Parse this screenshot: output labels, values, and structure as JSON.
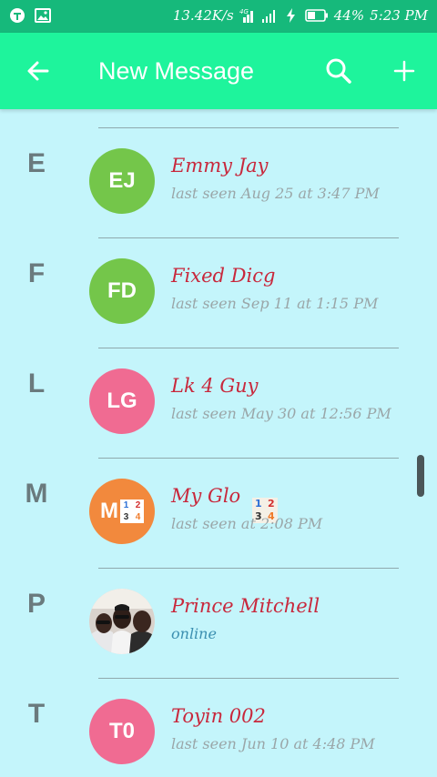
{
  "status_bar": {
    "net_speed": "13.42K/s",
    "battery": "44%",
    "time": "5:23 PM",
    "icons": [
      "app-notification-icon",
      "gallery-notification-icon",
      "lte-signal-icon",
      "signal-bars-icon",
      "charging-icon",
      "battery-icon"
    ]
  },
  "toolbar": {
    "title": "New Message",
    "back_icon": "arrow-left-icon",
    "search_icon": "search-icon",
    "add_icon": "plus-icon"
  },
  "contacts": [
    {
      "letter": "E",
      "initials": "EJ",
      "name": "Emmy Jay",
      "status": "last seen Aug 25 at 3:47 PM",
      "avatar_color": "#74c64a"
    },
    {
      "letter": "F",
      "initials": "FD",
      "name": "Fixed Dicg",
      "status": "last seen Sep 11 at 1:15 PM",
      "avatar_color": "#74c64a"
    },
    {
      "letter": "L",
      "initials": "LG",
      "name": "Lk 4 Guy",
      "status": "last seen May 30 at 12:56 PM",
      "avatar_color": "#f06b92"
    },
    {
      "letter": "M",
      "initials": "M",
      "name": "My Glo",
      "name_emoji": [
        "1",
        "2",
        "3",
        "4"
      ],
      "status": "last seen at 2:08 PM",
      "avatar_color": "#f2893d"
    },
    {
      "letter": "P",
      "initials": "",
      "name": "Prince Mitchell",
      "status": "online",
      "avatar_type": "photo"
    },
    {
      "letter": "T",
      "initials": "T0",
      "name": "Toyin 002",
      "status": "last seen Jun 10 at 4:48 PM",
      "avatar_color": "#f06b92"
    }
  ],
  "colors": {
    "status_bar": "#16b97b",
    "toolbar": "#1ef49c",
    "background": "#c4f5fb",
    "name_text": "#c8283c",
    "online_text": "#3b8fb0"
  }
}
